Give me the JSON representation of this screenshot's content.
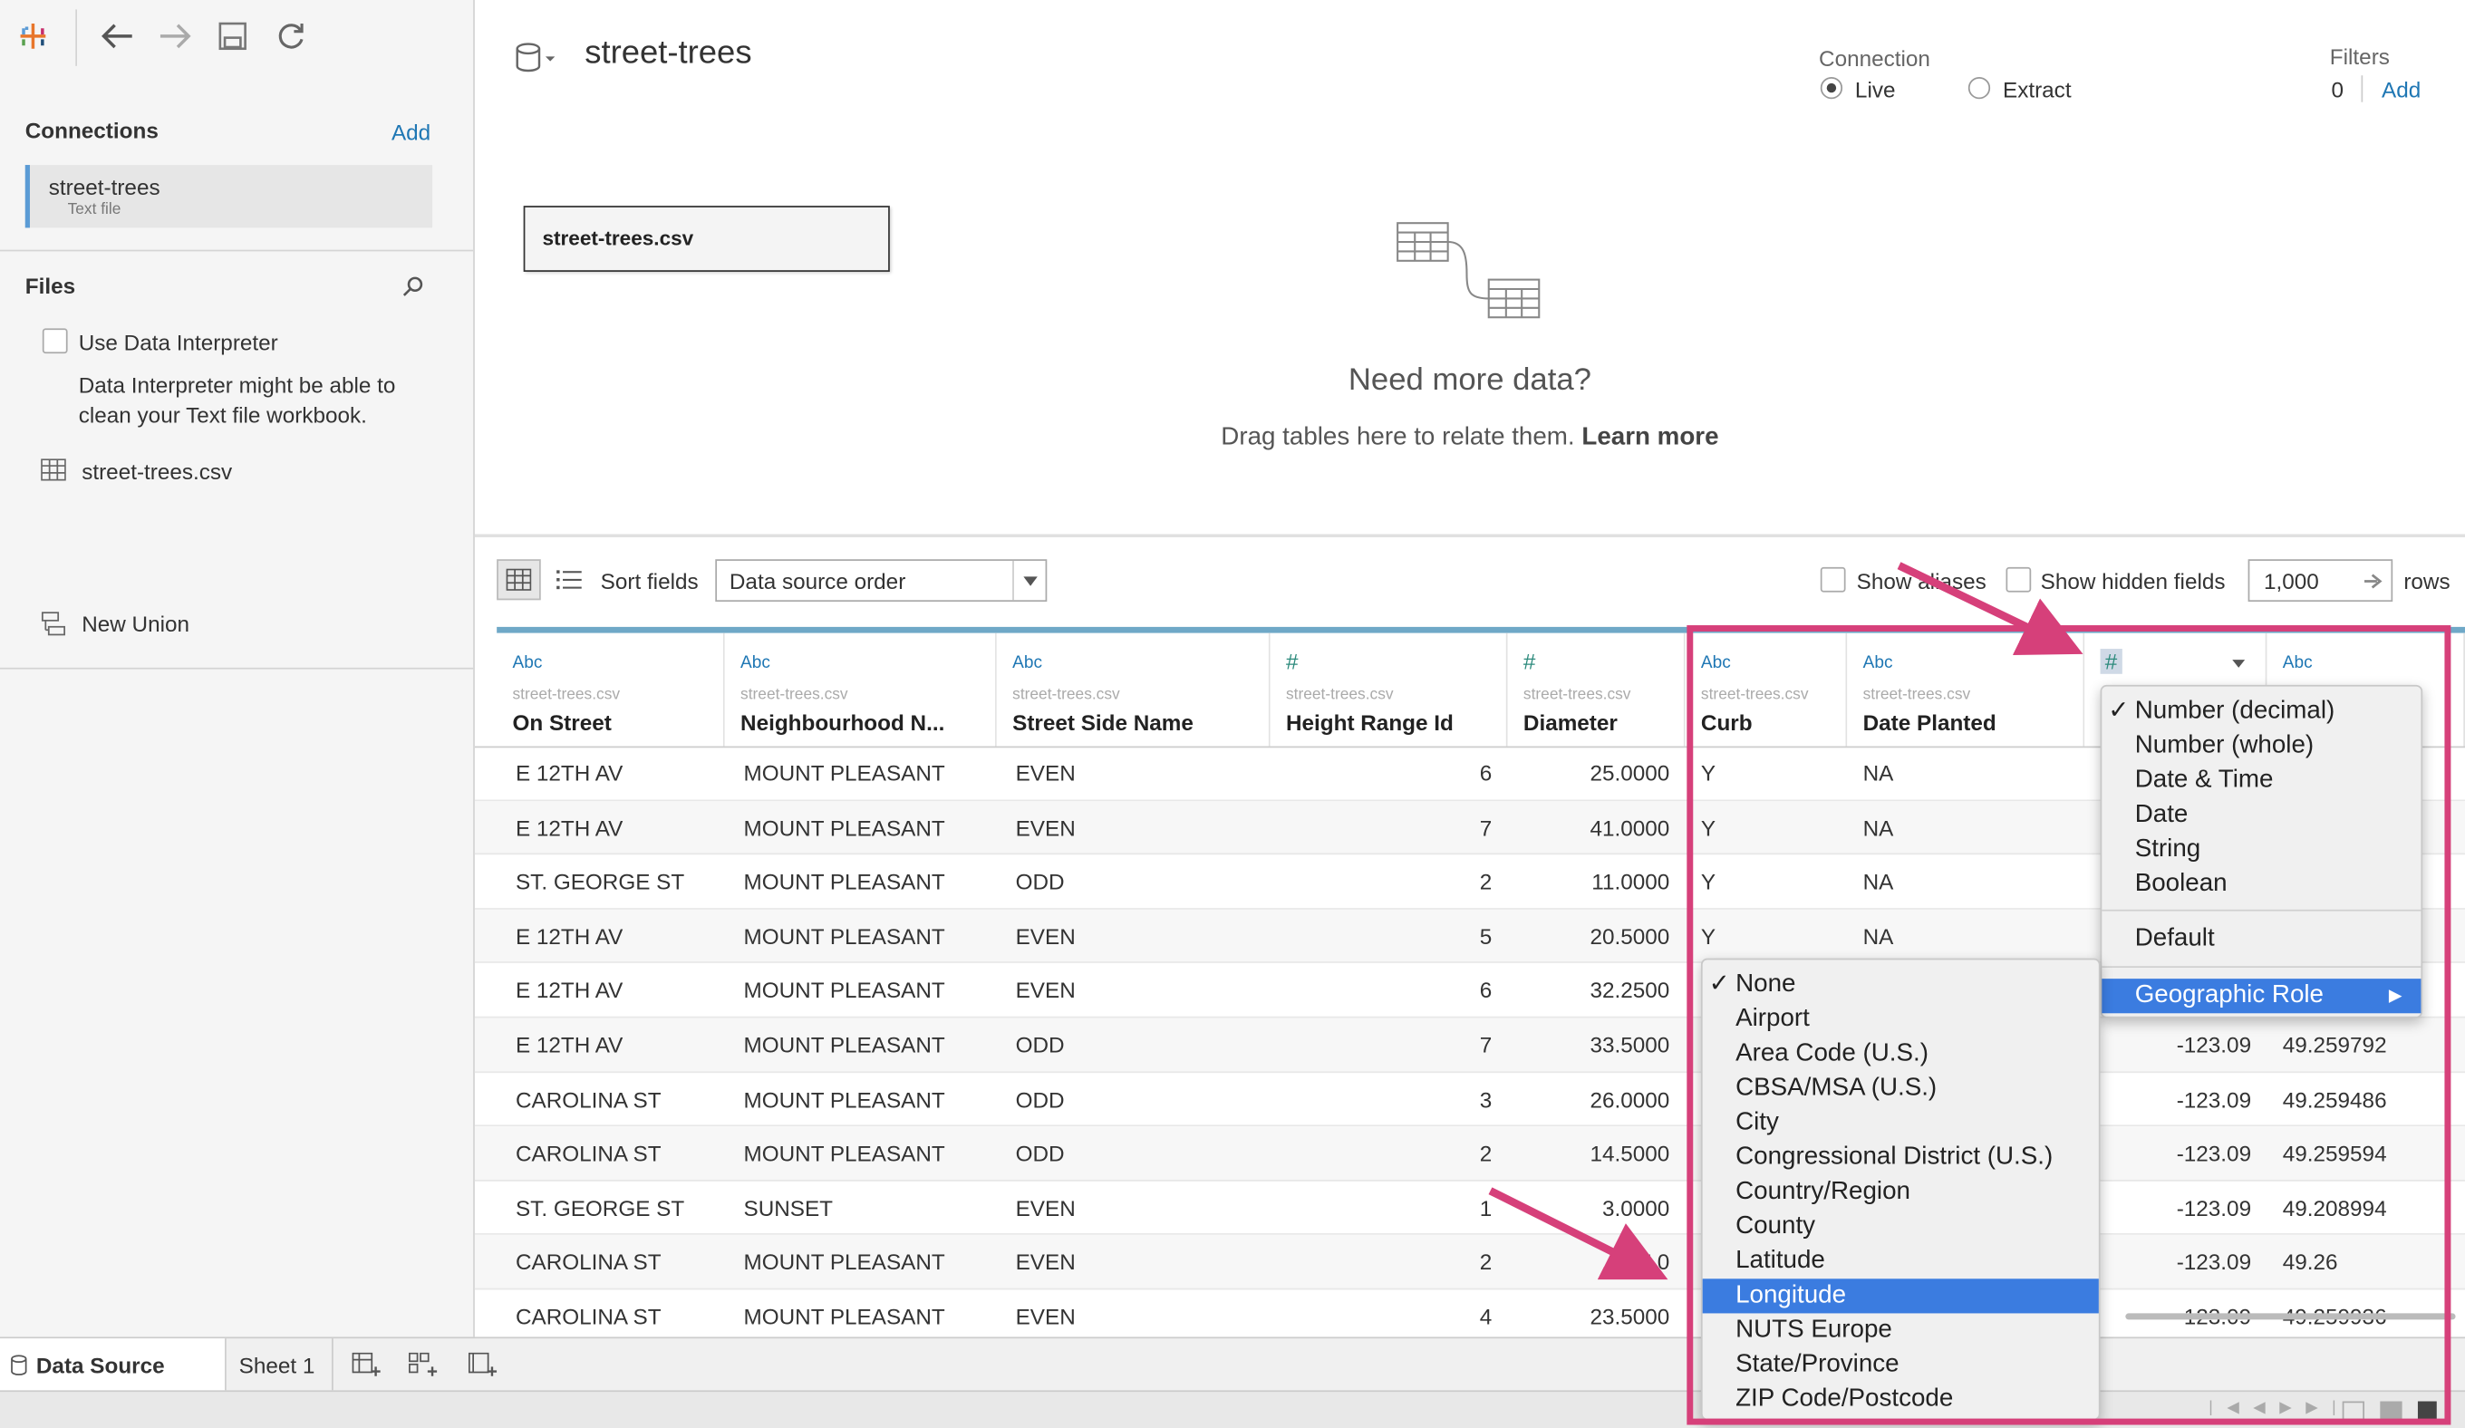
{
  "toolbar": {
    "logo": "tableau-logo-icon",
    "back": "back-arrow-icon",
    "forward": "forward-arrow-icon",
    "save": "save-icon",
    "refresh": "refresh-icon"
  },
  "sidebar": {
    "connections_heading": "Connections",
    "connections_add": "Add",
    "connection": {
      "name": "street-trees",
      "type": "Text file"
    },
    "files_heading": "Files",
    "use_data_interpreter": "Use Data Interpreter",
    "interpreter_note": "Data Interpreter might be able to clean your Text file workbook.",
    "file_name": "street-trees.csv",
    "new_union": "New Union"
  },
  "header": {
    "datasource_title": "street-trees",
    "connection_label": "Connection",
    "live_label": "Live",
    "extract_label": "Extract",
    "connection_mode": "Live",
    "filters_label": "Filters",
    "filters_count": "0",
    "filters_add": "Add"
  },
  "canvas": {
    "table_name": "street-trees.csv",
    "need_more_title": "Need more data?",
    "need_more_text": "Drag tables here to relate them.",
    "learn_more": "Learn more"
  },
  "grid_toolbar": {
    "sort_label": "Sort fields",
    "sort_value": "Data source order",
    "show_aliases": "Show aliases",
    "show_hidden": "Show hidden fields",
    "rows_value": "1,000",
    "rows_label": "rows"
  },
  "columns": [
    {
      "type": "Abc",
      "source": "street-trees.csv",
      "name": "On Street"
    },
    {
      "type": "Abc",
      "source": "street-trees.csv",
      "name": "Neighbourhood N..."
    },
    {
      "type": "Abc",
      "source": "street-trees.csv",
      "name": "Street Side Name"
    },
    {
      "type": "#",
      "source": "street-trees.csv",
      "name": "Height Range Id"
    },
    {
      "type": "#",
      "source": "street-trees.csv",
      "name": "Diameter"
    },
    {
      "type": "Abc",
      "source": "street-trees.csv",
      "name": "Curb"
    },
    {
      "type": "Abc",
      "source": "street-trees.csv",
      "name": "Date Planted"
    },
    {
      "type": "#",
      "source": "",
      "name": ""
    },
    {
      "type": "Abc",
      "source": "",
      "name": ""
    }
  ],
  "rows": [
    [
      "E 12TH AV",
      "MOUNT PLEASANT",
      "EVEN",
      "6",
      "25.0000",
      "Y",
      "NA",
      "",
      ""
    ],
    [
      "E 12TH AV",
      "MOUNT PLEASANT",
      "EVEN",
      "7",
      "41.0000",
      "Y",
      "NA",
      "",
      ""
    ],
    [
      "ST. GEORGE ST",
      "MOUNT PLEASANT",
      "ODD",
      "2",
      "11.0000",
      "Y",
      "NA",
      "",
      ""
    ],
    [
      "E 12TH AV",
      "MOUNT PLEASANT",
      "EVEN",
      "5",
      "20.5000",
      "Y",
      "NA",
      "",
      ""
    ],
    [
      "E 12TH AV",
      "MOUNT PLEASANT",
      "EVEN",
      "6",
      "32.2500",
      "",
      "",
      "",
      ""
    ],
    [
      "E 12TH AV",
      "MOUNT PLEASANT",
      "ODD",
      "7",
      "33.5000",
      "",
      "",
      "-123.09",
      "49.259792"
    ],
    [
      "CAROLINA ST",
      "MOUNT PLEASANT",
      "ODD",
      "3",
      "26.0000",
      "",
      "",
      "-123.09",
      "49.259486"
    ],
    [
      "CAROLINA ST",
      "MOUNT PLEASANT",
      "ODD",
      "2",
      "14.5000",
      "",
      "",
      "-123.09",
      "49.259594"
    ],
    [
      "ST. GEORGE ST",
      "SUNSET",
      "EVEN",
      "1",
      "3.0000",
      "",
      "",
      "-123.09",
      "49.208994"
    ],
    [
      "CAROLINA ST",
      "MOUNT PLEASANT",
      "EVEN",
      "2",
      "17.0",
      "",
      "",
      "-123.09",
      "49.26"
    ],
    [
      "CAROLINA ST",
      "MOUNT PLEASANT",
      "EVEN",
      "4",
      "23.5000",
      "",
      "",
      "-123.09",
      "49.259936"
    ]
  ],
  "type_menu": {
    "items": [
      "Number (decimal)",
      "Number (whole)",
      "Date & Time",
      "Date",
      "String",
      "Boolean"
    ],
    "checked": "Number (decimal)",
    "default_label": "Default",
    "geo_label": "Geographic Role",
    "geo_arrow": "▶"
  },
  "geo_menu": {
    "items": [
      "None",
      "Airport",
      "Area Code (U.S.)",
      "CBSA/MSA (U.S.)",
      "City",
      "Congressional District (U.S.)",
      "Country/Region",
      "County",
      "Latitude",
      "Longitude",
      "NUTS Europe",
      "State/Province",
      "ZIP Code/Postcode"
    ],
    "checked": "None",
    "highlighted": "Longitude"
  },
  "tabs": {
    "data_source": "Data Source",
    "sheet1": "Sheet 1"
  },
  "colors": {
    "accent": "#3b7ce0",
    "annotation": "#d6407a",
    "link": "#1f77b4"
  }
}
